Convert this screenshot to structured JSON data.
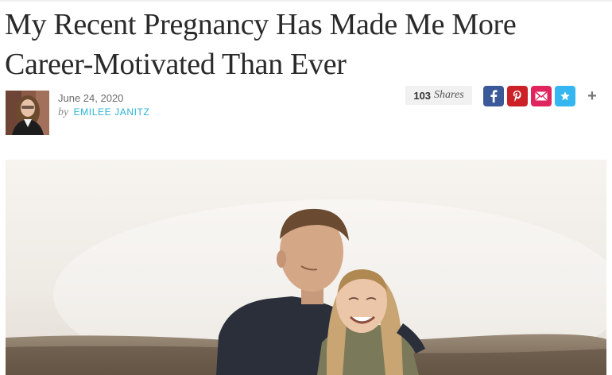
{
  "article": {
    "title": "My Recent Pregnancy Has Made Me More Career-Motivated Than Ever",
    "date": "June 24, 2020",
    "by_label": "by",
    "author": "EMILEE JANITZ"
  },
  "shares": {
    "count": "103",
    "label": "Shares"
  },
  "share_buttons": [
    {
      "name": "facebook",
      "icon": "facebook-icon",
      "color": "#3b5998"
    },
    {
      "name": "pinterest",
      "icon": "pinterest-icon",
      "color": "#cb2027"
    },
    {
      "name": "email",
      "icon": "mail-icon",
      "color": "#e0245e"
    },
    {
      "name": "favorite",
      "icon": "star-icon",
      "color": "#35b6f0"
    }
  ],
  "more_share": {
    "icon": "plus-icon",
    "label": "+"
  }
}
